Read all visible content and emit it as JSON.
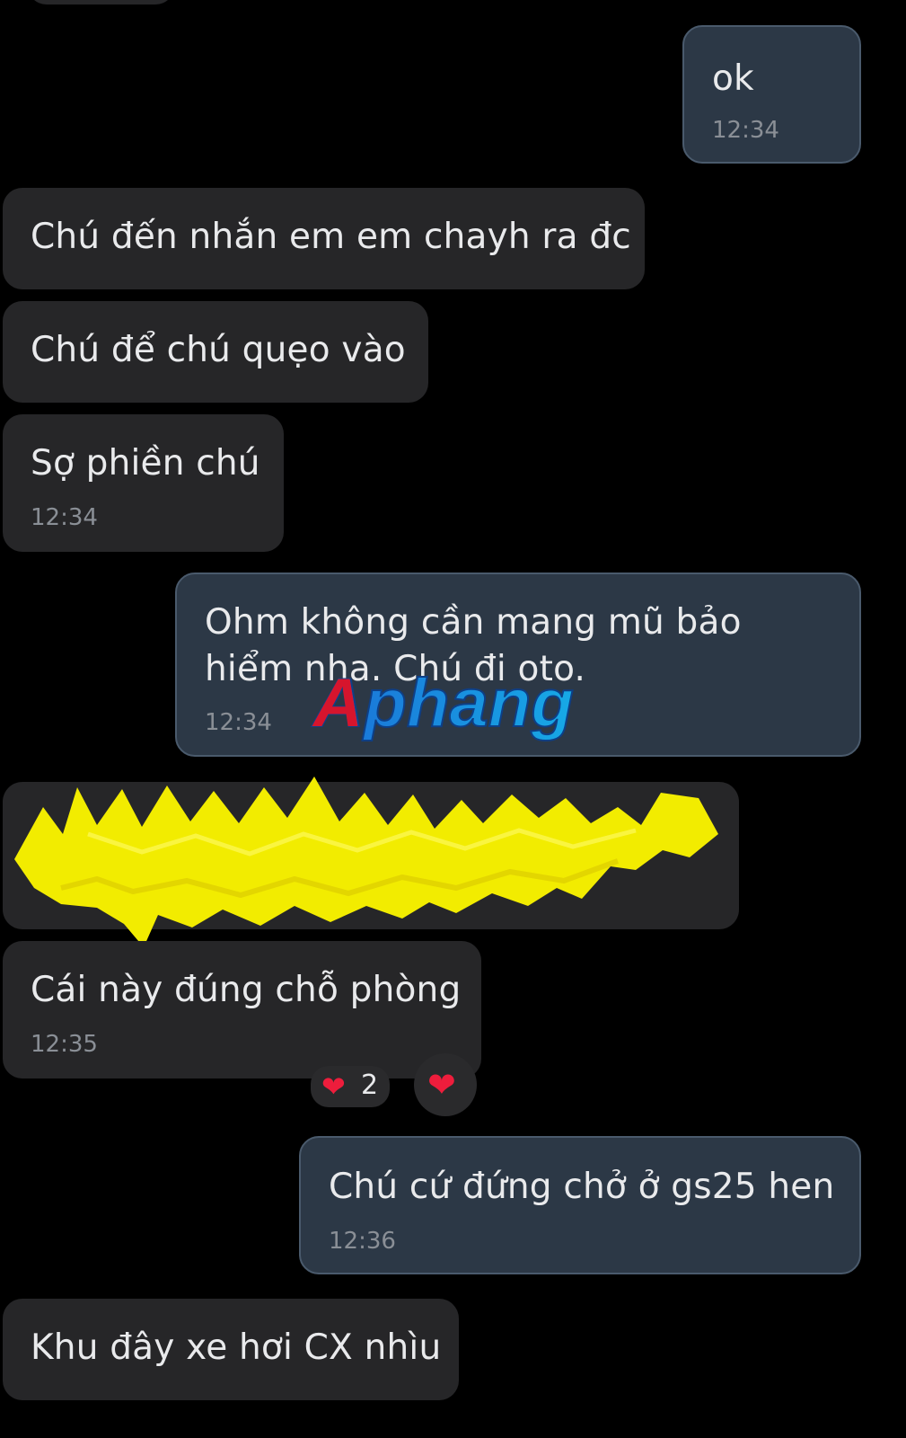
{
  "messages": [
    {
      "side": "out",
      "text": "ok",
      "time": "12:34"
    },
    {
      "side": "in",
      "text": "Chú đến nhắn em em chayh ra đc",
      "time": ""
    },
    {
      "side": "in",
      "text": "Chú để chú quẹo vào",
      "time": ""
    },
    {
      "side": "in",
      "text": "Sợ phiền chú",
      "time": "12:34"
    },
    {
      "side": "out",
      "text": "Ohm không cần mang mũ bảo hiểm nha. Chú đi oto.",
      "time": "12:34"
    },
    {
      "side": "in",
      "text": "",
      "time": "",
      "redacted": true
    },
    {
      "side": "in",
      "text": "Cái này đúng chỗ phòng",
      "time": "12:35"
    },
    {
      "side": "out",
      "text": "Chú cứ đứng chở ở gs25 hen",
      "time": "12:36"
    },
    {
      "side": "in",
      "text": "Khu đây xe hơi CX nhìu",
      "time": ""
    }
  ],
  "reactions": [
    {
      "icon": "heart-icon",
      "count": "2"
    },
    {
      "icon": "heart-icon",
      "count": ""
    }
  ],
  "watermark": "Aphang",
  "colors": {
    "background": "#000000",
    "incoming_bubble": "#262628",
    "outgoing_bubble": "#2c3846",
    "heart": "#ee1d3c",
    "redaction": "#f2ec00"
  }
}
